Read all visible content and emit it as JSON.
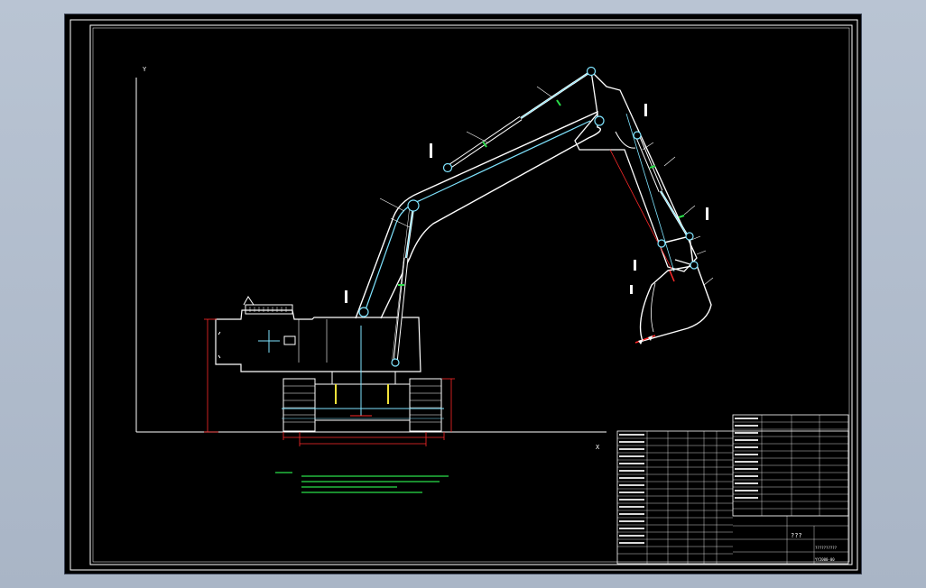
{
  "drawing": {
    "axis_y_label": "Y",
    "axis_x_label": "X",
    "title_block": {
      "title": "???",
      "label": "??????????",
      "drawing_no": "YY2000-00"
    }
  },
  "colors": {
    "background": "#000000",
    "line": "#ffffff",
    "hydraulic": "#7fe4ff",
    "dimension": "#ff2a2a",
    "note": "#2adf4a",
    "track": "#f2e23a"
  }
}
